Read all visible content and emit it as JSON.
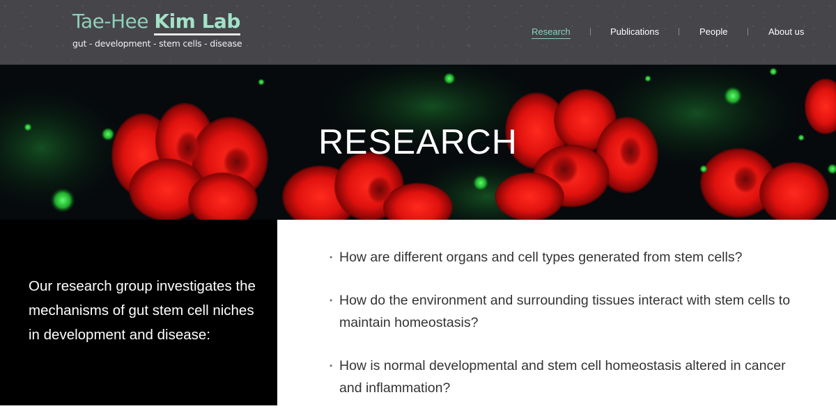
{
  "header": {
    "logo_title_part1": "Tae-Hee ",
    "logo_title_part2": "Kim Lab",
    "logo_subtitle": "gut - development - stem cells - disease",
    "nav": [
      {
        "label": "Research",
        "active": true
      },
      {
        "label": "Publications",
        "active": false
      },
      {
        "label": "People",
        "active": false
      },
      {
        "label": "About us",
        "active": false
      }
    ],
    "accent_color": "#8fd0b8"
  },
  "hero": {
    "title": "RESEARCH"
  },
  "intro": {
    "text": "Our research group investigates the mechanisms of gut stem cell niches in development and disease:"
  },
  "questions": [
    {
      "bullet": "•",
      "text": "How are different organs and cell types generated from stem cells?"
    },
    {
      "bullet": "•",
      "text": "How do the environment and surrounding tissues interact with stem cells to maintain homeostasis?"
    },
    {
      "bullet": "•",
      "text": "How is normal developmental and stem cell homeostasis altered in cancer and inflammation?"
    }
  ]
}
